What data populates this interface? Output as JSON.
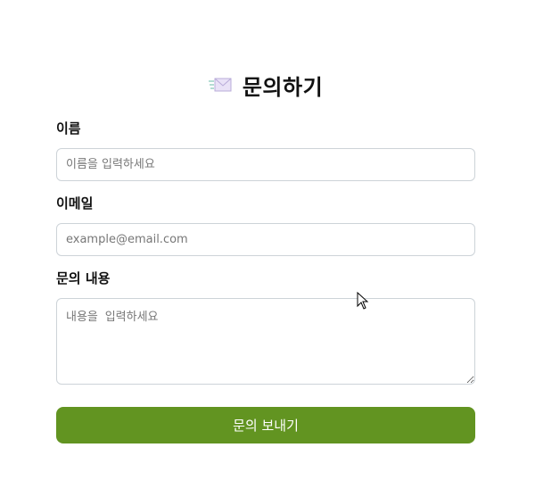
{
  "form": {
    "title": "문의하기",
    "title_icon": "envelope-icon",
    "name_label": "이름",
    "name_placeholder": "이름을 입력하세요",
    "email_label": "이메일",
    "email_placeholder": "example@email.com",
    "message_label": "문의 내용",
    "message_placeholder": "내용을 입력하세요",
    "submit_label": "문의 보내기"
  },
  "colors": {
    "accent": "#629421",
    "input_border": "#cdd3d8",
    "placeholder": "#777777"
  }
}
